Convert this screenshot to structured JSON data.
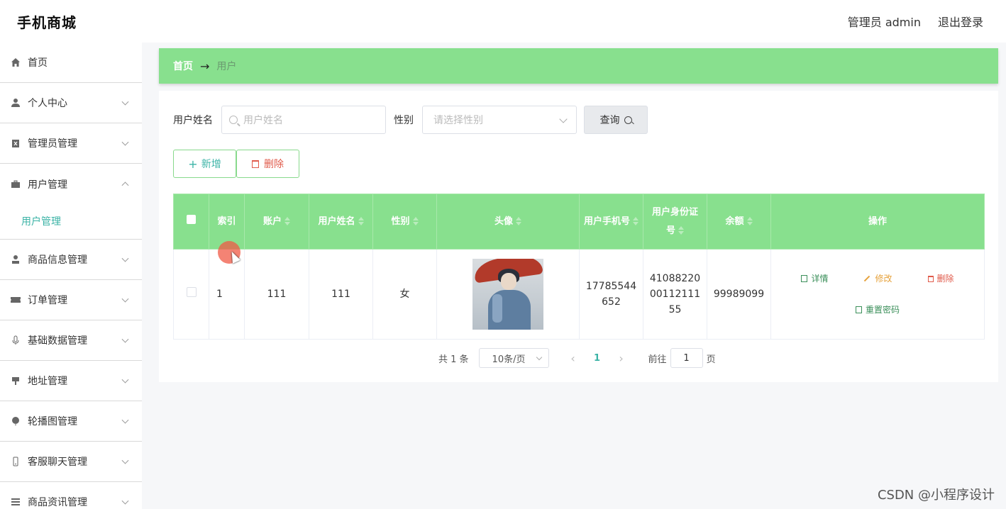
{
  "header": {
    "app_title": "手机商城",
    "admin_label": "管理员 admin",
    "logout_label": "退出登录"
  },
  "sidebar": {
    "items": [
      {
        "label": "首页",
        "icon": "home-icon"
      },
      {
        "label": "个人中心",
        "icon": "user-icon"
      },
      {
        "label": "管理员管理",
        "icon": "clipboard-icon"
      },
      {
        "label": "用户管理",
        "icon": "briefcase-icon"
      },
      {
        "label": "商品信息管理",
        "icon": "person-icon"
      },
      {
        "label": "订单管理",
        "icon": "ticket-icon"
      },
      {
        "label": "基础数据管理",
        "icon": "mic-icon"
      },
      {
        "label": "地址管理",
        "icon": "sign-icon"
      },
      {
        "label": "轮播图管理",
        "icon": "balloon-icon"
      },
      {
        "label": "客服聊天管理",
        "icon": "phone-icon"
      },
      {
        "label": "商品资讯管理",
        "icon": "list-icon"
      }
    ],
    "sub_active": "用户管理"
  },
  "breadcrumb": {
    "home": "首页",
    "arrow": "→",
    "current": "用户"
  },
  "search": {
    "name_label": "用户姓名",
    "name_placeholder": "用户姓名",
    "gender_label": "性别",
    "gender_placeholder": "请选择性别",
    "query_label": "查询"
  },
  "actions": {
    "add_label": "新增",
    "delete_label": "删除"
  },
  "table": {
    "headers": [
      "索引",
      "账户",
      "用户姓名",
      "性别",
      "头像",
      "用户手机号",
      "用户身份证号",
      "余额",
      "操作"
    ],
    "rows": [
      {
        "index": "1",
        "account": "111",
        "name": "111",
        "gender": "女",
        "phone": "17785544652",
        "id_card": "410882200011211155",
        "balance": "99989099"
      }
    ],
    "ops": {
      "detail": "详情",
      "edit": "修改",
      "delete": "删除",
      "reset": "重置密码"
    }
  },
  "pagination": {
    "total": "共 1 条",
    "page_size": "10条/页",
    "current": "1",
    "goto_label": "前往",
    "goto_value": "1",
    "page_suffix": "页"
  },
  "watermark": "CSDN @小程序设计"
}
